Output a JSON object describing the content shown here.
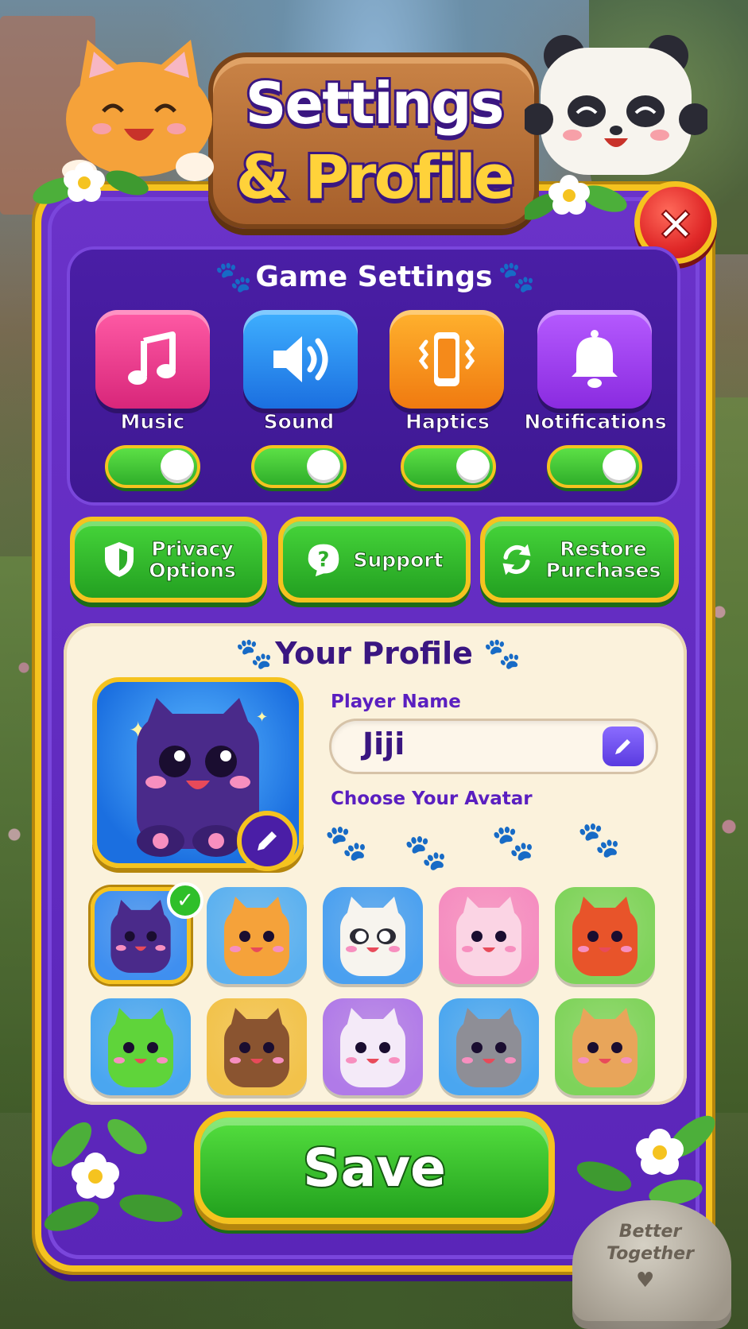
{
  "title": {
    "line1": "Settings",
    "amp": "&",
    "line2": "& Profile"
  },
  "close_label": "×",
  "game_settings": {
    "title": "Game Settings",
    "items": [
      {
        "label": "Music",
        "icon": "music-note-icon",
        "enabled": true,
        "color": "#e8318a"
      },
      {
        "label": "Sound",
        "icon": "speaker-icon",
        "enabled": true,
        "color": "#2a8ef0"
      },
      {
        "label": "Haptics",
        "icon": "vibrating-phone-icon",
        "enabled": true,
        "color": "#f7941d"
      },
      {
        "label": "Notifications",
        "icon": "bell-icon",
        "enabled": true,
        "color": "#9b3cf0"
      }
    ]
  },
  "actions": {
    "privacy": {
      "line1": "Privacy",
      "line2": "Options",
      "icon": "shield-icon"
    },
    "support": {
      "label": "Support",
      "icon": "question-bubble-icon"
    },
    "restore": {
      "line1": "Restore",
      "line2": "Purchases",
      "icon": "refresh-icon"
    }
  },
  "profile": {
    "title": "Your Profile",
    "player_name_label": "Player Name",
    "player_name": "Jiji",
    "choose_avatar_label": "Choose Your Avatar",
    "selected_avatar": "purple-cat",
    "avatars": [
      {
        "id": "purple-cat",
        "bg": "#3f8ff0",
        "color": "#4a2a8a"
      },
      {
        "id": "orange-cat",
        "bg": "#5ab0f0",
        "color": "#f5a23a"
      },
      {
        "id": "panda",
        "bg": "#4aa0f0",
        "color": "#f7f4ee"
      },
      {
        "id": "bunny",
        "bg": "#f58cc0",
        "color": "#fbd4e4"
      },
      {
        "id": "fox",
        "bg": "#7ed35a",
        "color": "#e8542a"
      },
      {
        "id": "frog",
        "bg": "#4aa6f0",
        "color": "#5fd43a"
      },
      {
        "id": "bear",
        "bg": "#f2c24a",
        "color": "#8a5430"
      },
      {
        "id": "lilac-cat",
        "bg": "#b07ae8",
        "color": "#f4eaf8"
      },
      {
        "id": "grey-cat",
        "bg": "#4aa6f0",
        "color": "#8e8e96"
      },
      {
        "id": "puppy",
        "bg": "#7ed35a",
        "color": "#e8a55a"
      }
    ]
  },
  "save_label": "Save",
  "stone": {
    "line1": "Better",
    "line2": "Together",
    "heart": "♥"
  },
  "colors": {
    "panel": "#5a25b8",
    "gold": "#f5c31f",
    "green": "#2fae2a",
    "profile_bg": "#fbf2dc",
    "text_purple": "#3a1681"
  }
}
